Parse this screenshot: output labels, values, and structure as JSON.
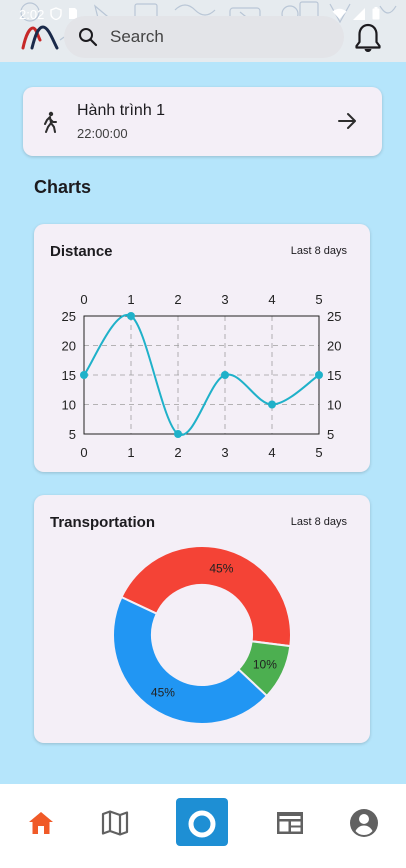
{
  "status_bar": {
    "time": "2:02",
    "icons": [
      "shield-icon",
      "sim-icon",
      "wifi-icon",
      "signal-icon",
      "battery-icon"
    ]
  },
  "header": {
    "logo": "app-logo",
    "search": {
      "placeholder": "Search",
      "value": ""
    },
    "notification_icon": "bell-icon"
  },
  "journey": {
    "title": "Hành trình 1",
    "time": "22:00:00",
    "icon": "walk-icon",
    "action_icon": "arrow-right-icon"
  },
  "section_title": "Charts",
  "distance_card": {
    "title": "Distance",
    "period": "Last 8 days"
  },
  "transport_card": {
    "title": "Transportation",
    "period": "Last 8 days"
  },
  "chart_data": [
    {
      "type": "line",
      "title": "Distance",
      "x": [
        0,
        1,
        2,
        3,
        4,
        5
      ],
      "xticks": [
        "0",
        "1",
        "2",
        "3",
        "4",
        "5"
      ],
      "yticks": [
        "5",
        "10",
        "15",
        "20",
        "25"
      ],
      "series": [
        {
          "values": [
            15,
            25,
            5,
            15,
            10,
            15
          ]
        }
      ],
      "xlim": [
        0,
        5
      ],
      "ylim": [
        5,
        25
      ],
      "grid": true,
      "curve": "smooth",
      "color": "#1fb1c9"
    },
    {
      "type": "pie",
      "title": "Transportation",
      "donut": true,
      "slices": [
        {
          "value": 45,
          "label": "45%",
          "color": "#f44336"
        },
        {
          "value": 10,
          "label": "10%",
          "color": "#4caf50"
        },
        {
          "value": 45,
          "label": "45%",
          "color": "#2196f3"
        }
      ]
    }
  ],
  "bottom_nav": {
    "items": [
      "home-icon",
      "map-icon",
      "camera-icon",
      "news-icon",
      "profile-icon"
    ],
    "active_color": "#f05a28",
    "inactive_color": "#616161",
    "camera_bg": "#1e8fd4"
  }
}
